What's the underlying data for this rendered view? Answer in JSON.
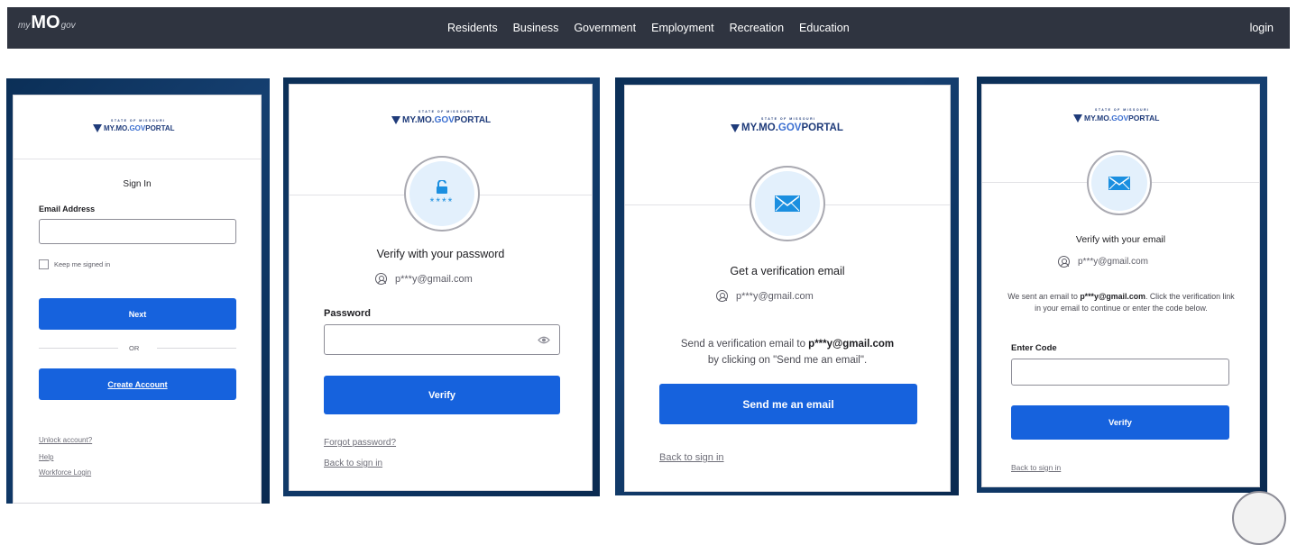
{
  "topbar": {
    "logo": {
      "pre": "my",
      "mid": "MO",
      "post": "gov"
    },
    "nav": [
      "Residents",
      "Business",
      "Government",
      "Employment",
      "Recreation",
      "Education"
    ],
    "login": "login"
  },
  "brand": {
    "state": "STATE OF MISSOURI",
    "name": "MY.MO.",
    "gov": "GOV",
    "portal": " PORTAL"
  },
  "panel1": {
    "heading": "Sign In",
    "email_label": "Email Address",
    "email_value": "",
    "keep_signed_in": "Keep me signed in",
    "next": "Next",
    "or": "OR",
    "create": "Create Account",
    "links": [
      "Unlock account?",
      "Help",
      "Workforce Login"
    ]
  },
  "panel2": {
    "lock_stars": "****",
    "heading": "Verify with your password",
    "user": "p***y@gmail.com",
    "password_label": "Password",
    "password_value": "",
    "verify": "Verify",
    "links": [
      "Forgot password?",
      "Back to sign in"
    ]
  },
  "panel3": {
    "heading": "Get a verification email",
    "user": "p***y@gmail.com",
    "send_prefix": "Send a verification email to ",
    "send_email": "p***y@gmail.com",
    "send_suffix": "by clicking on \"Send me an email\".",
    "button": "Send me an email",
    "back": "Back to sign in"
  },
  "panel4": {
    "heading": "Verify with your email",
    "user": "p***y@gmail.com",
    "sent_prefix": "We sent an email to ",
    "sent_email": "p***y@gmail.com",
    "sent_suffix": ". Click the verification link in your email to continue or enter the code below.",
    "code_label": "Enter Code",
    "code_value": "",
    "verify": "Verify",
    "back": "Back to sign in"
  },
  "colors": {
    "accent": "#1662dd",
    "nav_bg": "#2f3440",
    "icon_blue": "#1b8fe0",
    "backdrop": "#0d3461"
  }
}
